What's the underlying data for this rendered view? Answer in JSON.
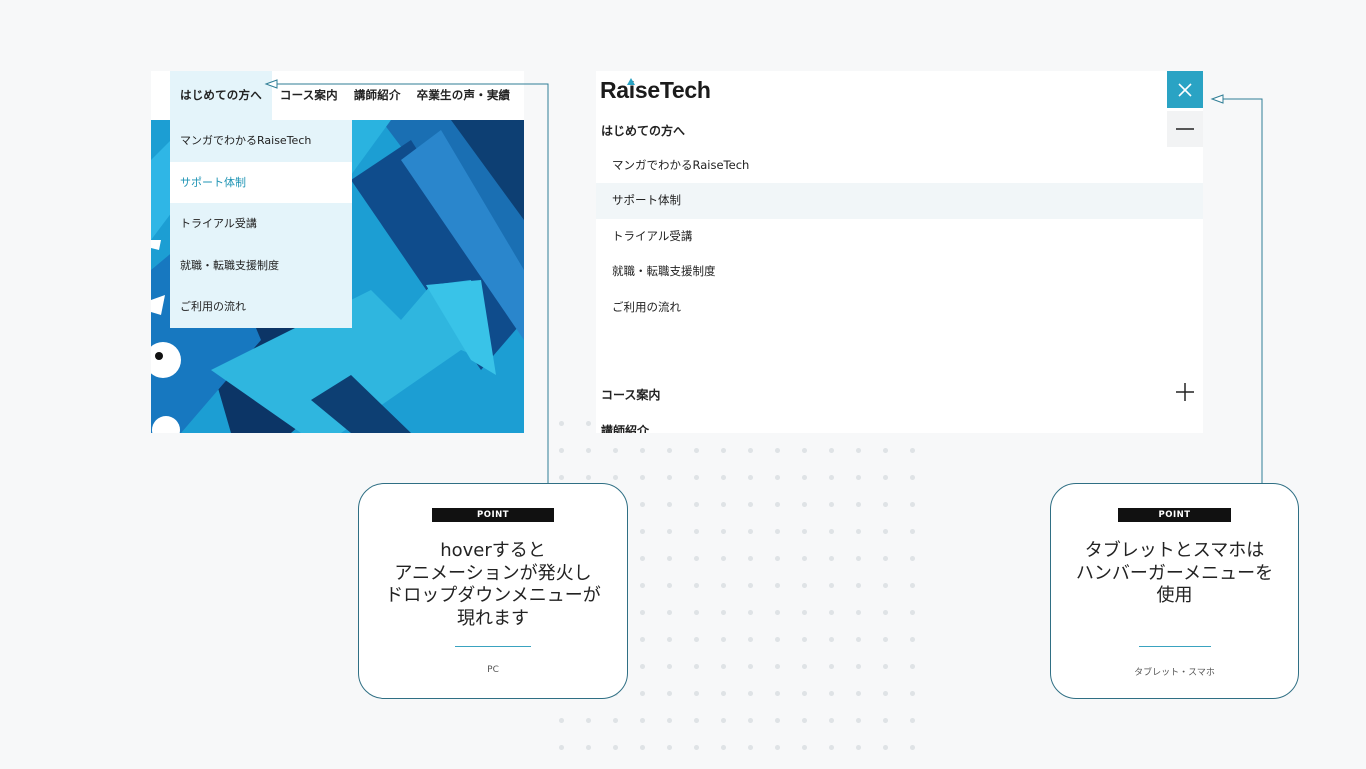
{
  "pc_panel": {
    "nav": [
      "はじめての方へ",
      "コース案内",
      "講師紹介",
      "卒業生の声・実績"
    ],
    "dropdown": [
      "マンガでわかるRaiseTech",
      "サポート体制",
      "トライアル受講",
      "就職・転職支援制度",
      "ご利用の流れ"
    ],
    "selected_index": 1
  },
  "tablet_panel": {
    "logo": "RaiseTech",
    "section_open": "はじめての方へ",
    "sub_items": [
      "マンガでわかるRaiseTech",
      "サポート体制",
      "トライアル受講",
      "就職・転職支援制度",
      "ご利用の流れ"
    ],
    "selected_index": 1,
    "section_2": "コース案内",
    "section_3": "講師紹介",
    "icons": [
      "close-icon",
      "minus-icon",
      "plus-icon"
    ]
  },
  "callout_pc": {
    "badge": "POINT",
    "lines": [
      "hoverすると",
      "アニメーションが発火し",
      "ドロップダウンメニューが",
      "現れます"
    ],
    "footer": "PC"
  },
  "callout_tablet": {
    "badge": "POINT",
    "lines": [
      "タブレットとスマホは",
      "ハンバーガーメニューを",
      "使用"
    ],
    "footer": "タブレット・スマホ"
  },
  "colors": {
    "accent": "#2aa3c4",
    "dropdown_bg": "#e4f4fa",
    "selected_text": "#1f94b4",
    "callout_border": "#2f6f84"
  }
}
